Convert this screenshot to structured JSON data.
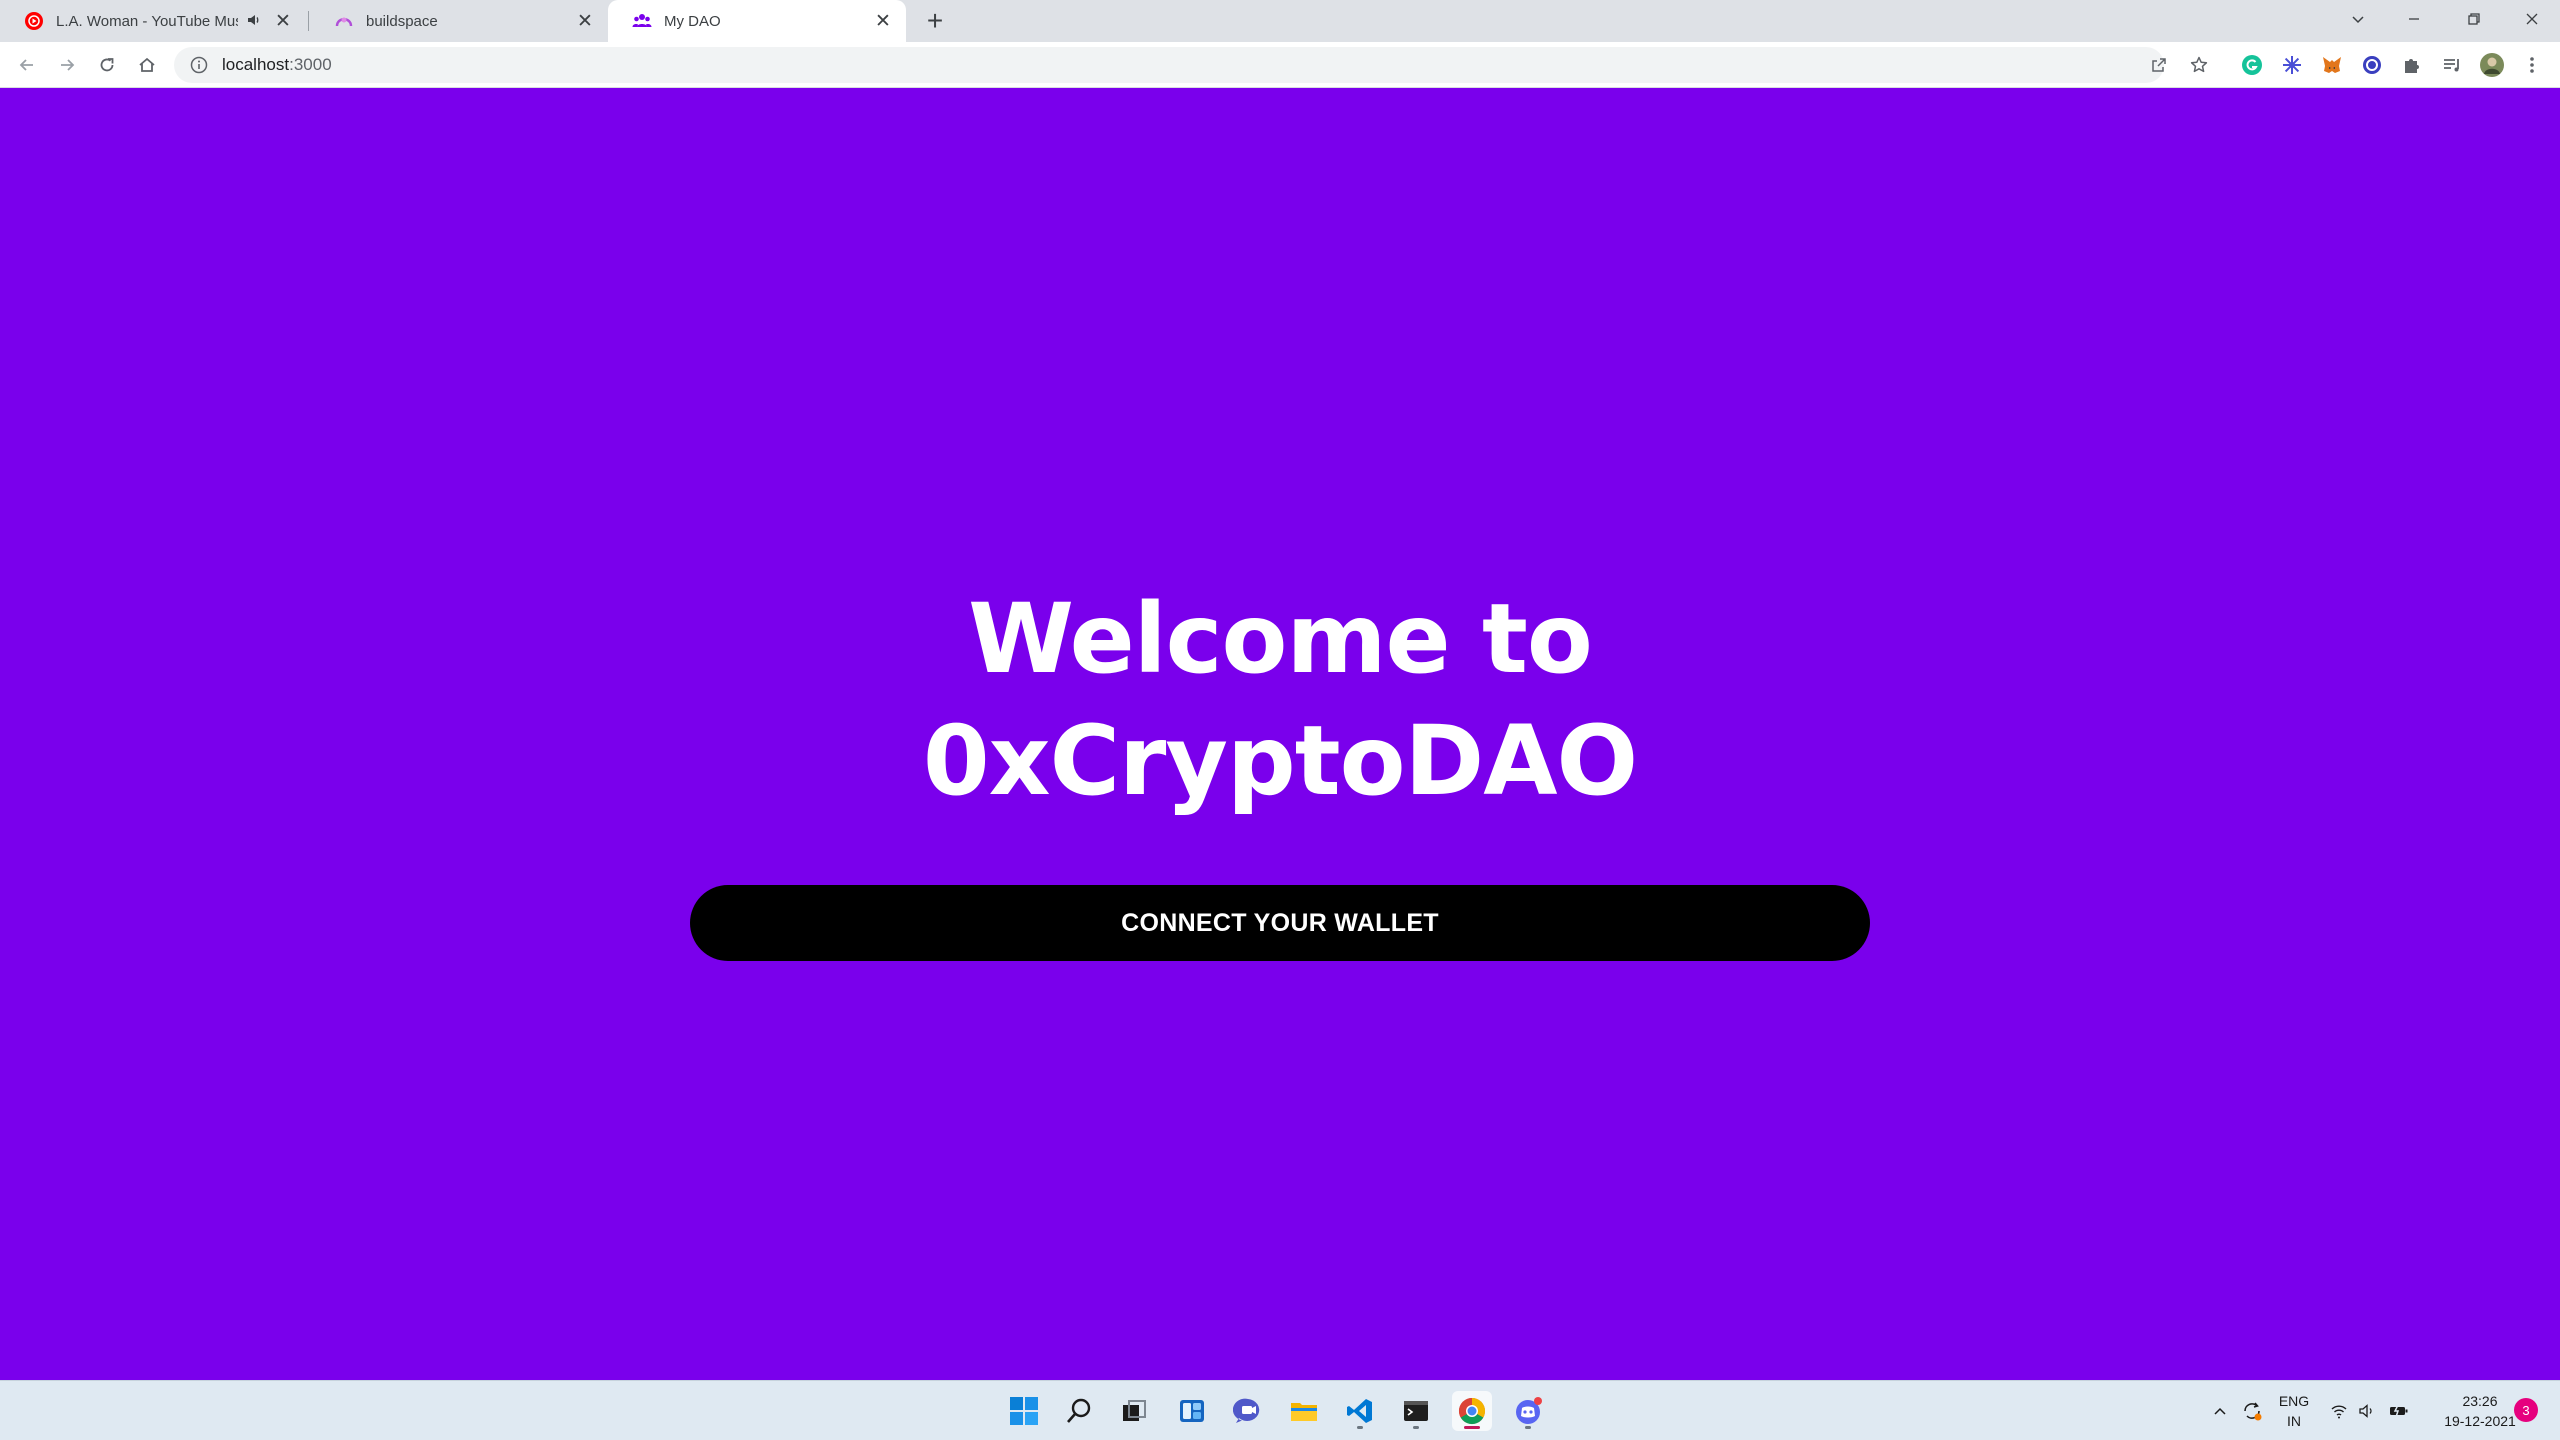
{
  "browser": {
    "tabs": [
      {
        "title": "L.A. Woman - YouTube Music",
        "favicon": "youtube-music-icon",
        "audio": true
      },
      {
        "title": "buildspace",
        "favicon": "buildspace-icon"
      },
      {
        "title": "My DAO",
        "favicon": "people-icon",
        "active": true
      }
    ],
    "address": {
      "host": "localhost",
      "port": ":3000"
    }
  },
  "page": {
    "heading_line1": "Welcome to",
    "heading_line2": "0xCryptoDAO",
    "connect_label": "CONNECT YOUR WALLET",
    "background_color": "#7a00ec",
    "button_color": "#000000"
  },
  "taskbar": {
    "apps": [
      "start-icon",
      "search-icon",
      "task-view-icon",
      "widgets-icon",
      "teams-chat-icon",
      "file-explorer-icon",
      "vscode-icon",
      "terminal-icon",
      "chrome-icon",
      "discord-icon"
    ],
    "lang_top": "ENG",
    "lang_bottom": "IN",
    "time": "23:26",
    "date": "19-12-2021",
    "notifications": "3"
  }
}
